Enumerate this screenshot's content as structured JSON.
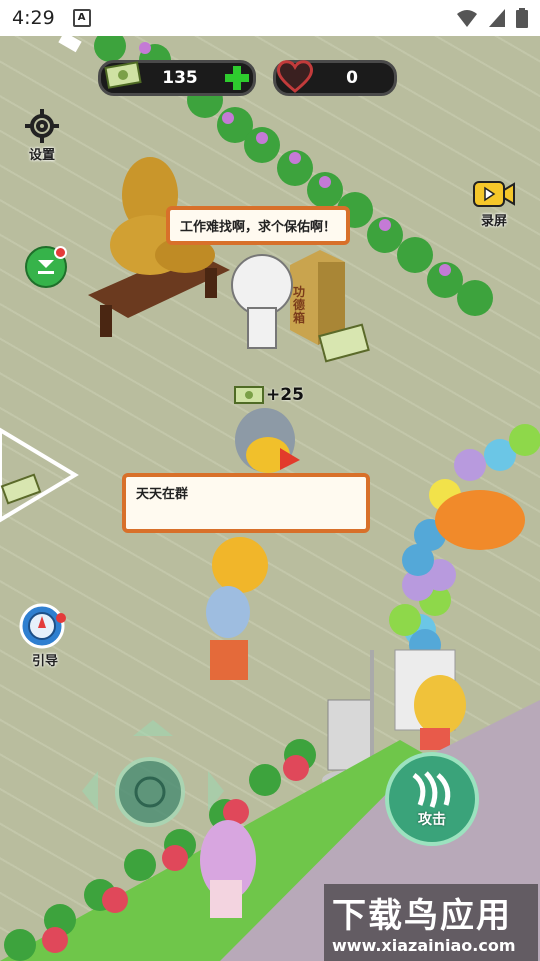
{
  "status_bar": {
    "time": "4:29",
    "app_badge": "A"
  },
  "hud": {
    "money": "135",
    "hearts": "0"
  },
  "buttons": {
    "settings_label": "设置",
    "record_label": "录屏",
    "guide_label": "引导",
    "attack_label": "攻击"
  },
  "bubbles": {
    "top": "工作难找啊，求个保佑啊！",
    "middle": "天天在群"
  },
  "reward": {
    "amount": "+25"
  },
  "donation_box": {
    "text": "功德箱"
  },
  "watermark": {
    "title": "下载鸟应用",
    "url": "www.xiazainiao.com"
  },
  "colors": {
    "bubble_border": "#d8702a",
    "plus": "#2ecc2e",
    "grass": "#6fc64a"
  }
}
